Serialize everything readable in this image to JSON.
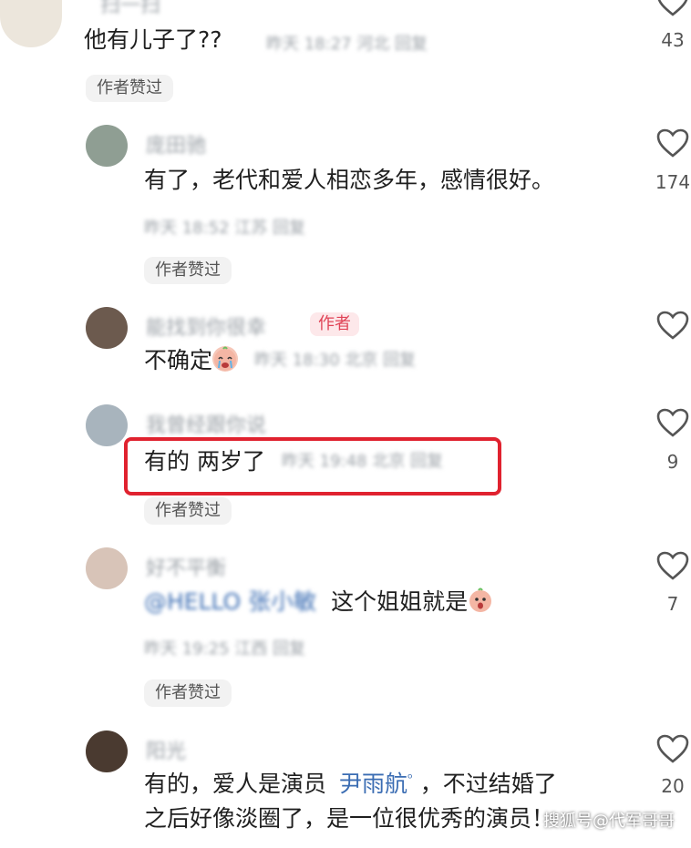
{
  "comments": [
    {
      "username": "扫一扫",
      "text": "他有儿子了??",
      "meta": "昨天 18:27 河北 回复",
      "badge": "作者赞过",
      "likes": "43"
    },
    {
      "username": "庞田驰",
      "text": "有了，老代和爱人相恋多年，感情很好。",
      "meta": "昨天 18:52 江苏 回复",
      "badge": "作者赞过",
      "likes": "174"
    },
    {
      "username": "能找到你很幸",
      "author_tag": "作者",
      "text": "不确定",
      "meta": "昨天 18:30 北京 回复",
      "likes": ""
    },
    {
      "username": "我曾经跟你说",
      "text": "有的 两岁了",
      "meta": "昨天 19:48 北京 回复",
      "badge": "作者赞过",
      "likes": "9"
    },
    {
      "username": "好不平衡",
      "mention": "@HELLO 张小敏",
      "text": "这个姐姐就是",
      "meta": "昨天 19:25 江西 回复",
      "badge": "作者赞过",
      "likes": "7"
    },
    {
      "username": "阳光",
      "text_line1_before": "有的，爱人是演员",
      "mention_name": "尹雨航",
      "text_line1_after": "，不过结婚了",
      "text_line2": "之后好像淡圈了，是一位很优秀的演员！",
      "likes": "20"
    }
  ],
  "watermark": "搜狐号@代军哥哥",
  "colors": {
    "highlight": "#e0222f",
    "author_tag_text": "#e04457",
    "mention": "#3b6db3"
  }
}
